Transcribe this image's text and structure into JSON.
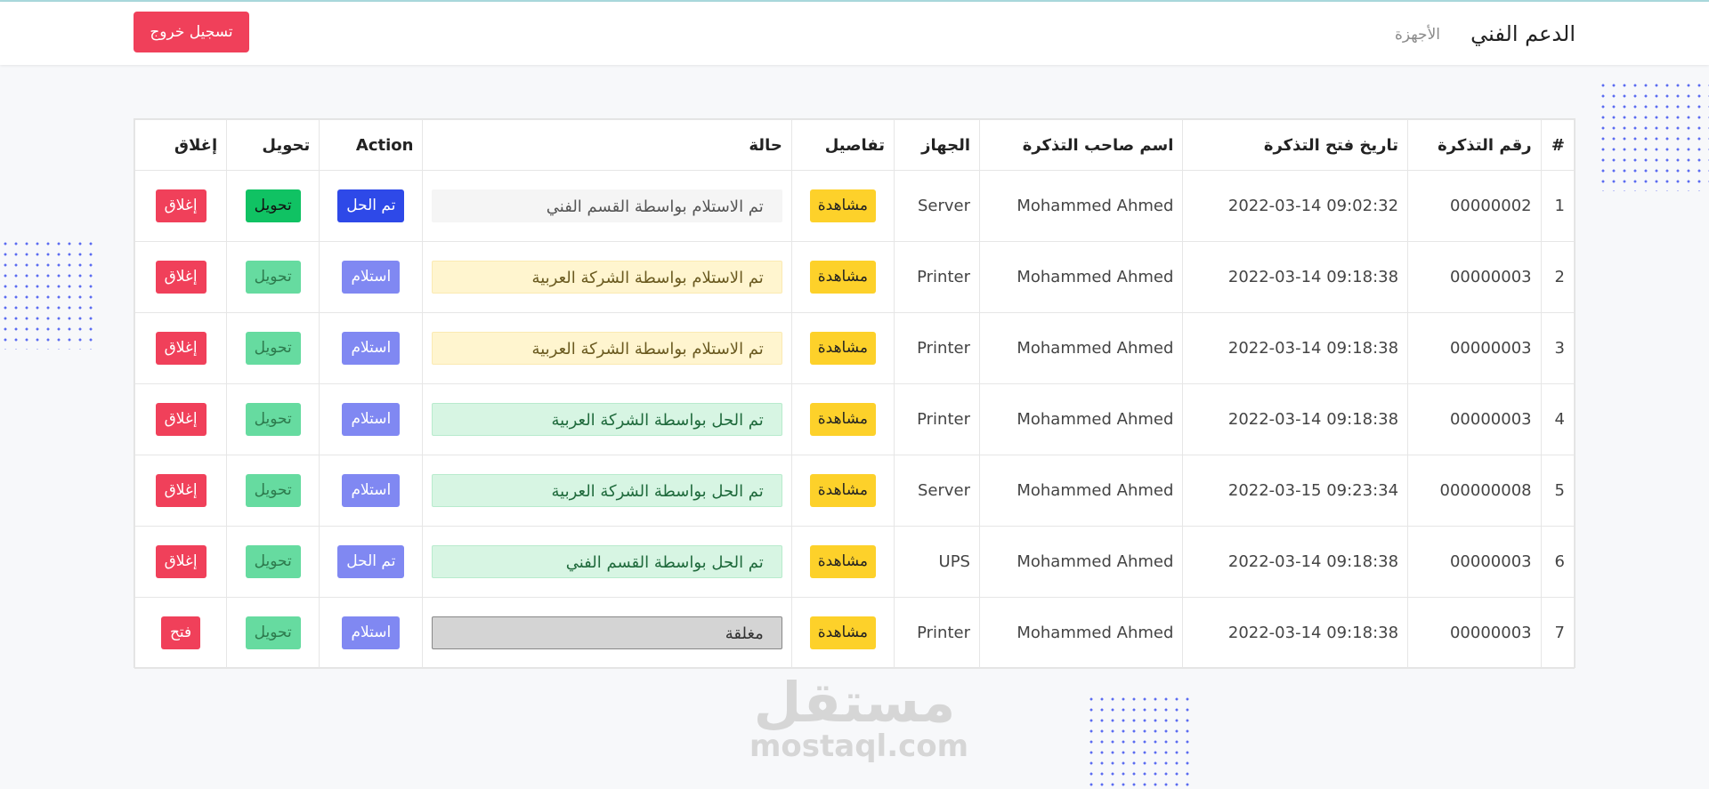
{
  "nav": {
    "brand": "الدعم الفني",
    "devices_link": "الأجهزة",
    "logout_label": "تسجيل خروج"
  },
  "table": {
    "headers": [
      "#",
      "رقم التذكرة",
      "تاريخ فتح التذكرة",
      "اسم صاحب التذكرة",
      "الجهاز",
      "تفاصيل",
      "حالة",
      "Action",
      "تحويل",
      "إغلاق"
    ],
    "rows": [
      {
        "index": "1",
        "ticket": "00000002",
        "date": "2022-03-14 09:02:32",
        "owner": "Mohammed Ahmed",
        "device": "Server",
        "details": "مشاهدة",
        "status": "تم الاستلام بواسطة القسم الفني",
        "action": "تم الحل",
        "transfer": "تحويل",
        "close": "إغلاق"
      },
      {
        "index": "2",
        "ticket": "00000003",
        "date": "2022-03-14 09:18:38",
        "owner": "Mohammed Ahmed",
        "device": "Printer",
        "details": "مشاهدة",
        "status": "تم الاستلام بواسطة الشركة العربية",
        "action": "استلام",
        "transfer": "تحويل",
        "close": "إغلاق"
      },
      {
        "index": "3",
        "ticket": "00000003",
        "date": "2022-03-14 09:18:38",
        "owner": "Mohammed Ahmed",
        "device": "Printer",
        "details": "مشاهدة",
        "status": "تم الاستلام بواسطة الشركة العربية",
        "action": "استلام",
        "transfer": "تحويل",
        "close": "إغلاق"
      },
      {
        "index": "4",
        "ticket": "00000003",
        "date": "2022-03-14 09:18:38",
        "owner": "Mohammed Ahmed",
        "device": "Printer",
        "details": "مشاهدة",
        "status": "تم الحل بواسطة الشركة العربية",
        "action": "استلام",
        "transfer": "تحويل",
        "close": "إغلاق"
      },
      {
        "index": "5",
        "ticket": "000000008",
        "date": "2022-03-15 09:23:34",
        "owner": "Mohammed Ahmed",
        "device": "Server",
        "details": "مشاهدة",
        "status": "تم الحل بواسطة الشركة العربية",
        "action": "استلام",
        "transfer": "تحويل",
        "close": "إغلاق"
      },
      {
        "index": "6",
        "ticket": "00000003",
        "date": "2022-03-14 09:18:38",
        "owner": "Mohammed Ahmed",
        "device": "UPS",
        "details": "مشاهدة",
        "status": "تم الحل بواسطة القسم الفني",
        "action": "تم الحل",
        "transfer": "تحويل",
        "close": "إغلاق"
      },
      {
        "index": "7",
        "ticket": "00000003",
        "date": "2022-03-14 09:18:38",
        "owner": "Mohammed Ahmed",
        "device": "Printer",
        "details": "مشاهدة",
        "status": "مغلقة",
        "action": "استلام",
        "transfer": "تحويل",
        "close": "فتح"
      }
    ]
  },
  "colors": {
    "danger": "#f0405a",
    "warning": "#fdd12a",
    "primary": "#2e49e8",
    "primary_muted": "#8088f2",
    "success": "#10c263",
    "success_muted": "#66dba0"
  },
  "watermark": {
    "arabic": "مستقل",
    "latin": "mostaql.com"
  }
}
